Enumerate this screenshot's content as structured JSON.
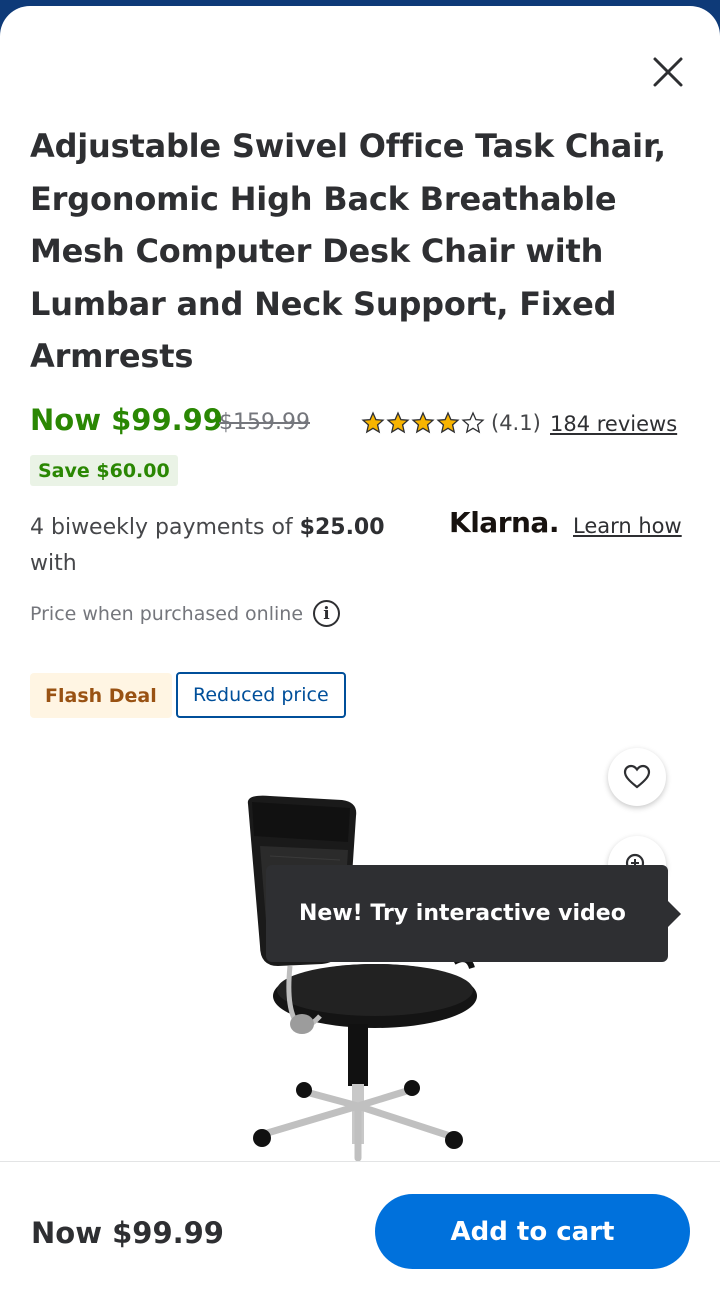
{
  "product": {
    "title": "Adjustable Swivel Office Task Chair, Ergonomic High Back Breathable Mesh Computer Desk Chair with Lumbar and Neck Support, Fixed Armrests"
  },
  "pricing": {
    "now": "Now $99.99",
    "was": "$159.99",
    "save": "Save $60.00",
    "online_note": "Price when purchased online"
  },
  "rating": {
    "value": "(4.1)",
    "stars": 4.1,
    "reviews": "184 reviews"
  },
  "klarna": {
    "text_prefix": "4 biweekly payments of ",
    "amount": "$25.00",
    "text_suffix": " with",
    "logo": "Klarna.",
    "learn_how": "Learn how"
  },
  "badges": {
    "flash_deal": "Flash Deal",
    "reduced_price": "Reduced price"
  },
  "tooltip": {
    "text": "New! Try interactive video"
  },
  "bottom_bar": {
    "price": "Now $99.99",
    "add_to_cart": "Add to cart"
  },
  "colors": {
    "price_green": "#2a8703",
    "primary_blue": "#0071dc",
    "tooltip_bg": "#2e2f32",
    "star": "#f8b400"
  },
  "icons": [
    "close-icon",
    "star-icon",
    "info-icon",
    "heart-icon",
    "zoom-icon"
  ]
}
